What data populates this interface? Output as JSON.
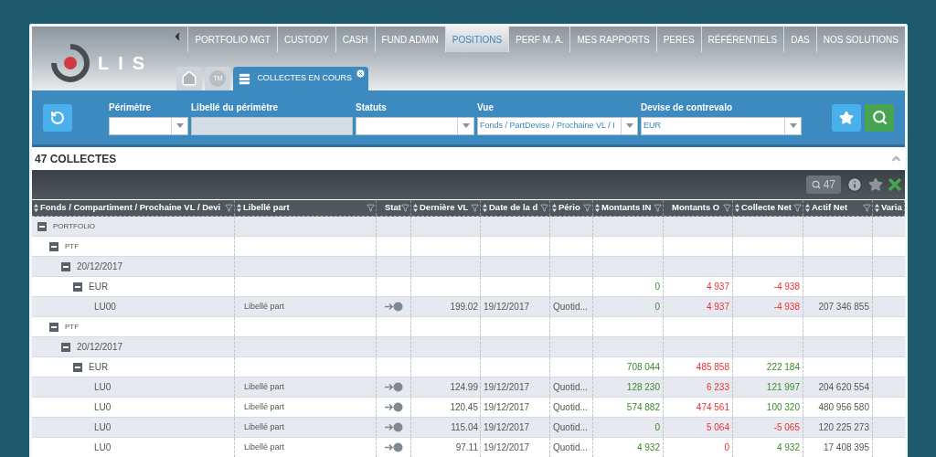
{
  "logo": {
    "text": "LIS"
  },
  "nav": {
    "tabs": [
      {
        "label": "PORTFOLIO MGT",
        "selected": false
      },
      {
        "label": "CUSTODY",
        "selected": false
      },
      {
        "label": "CASH",
        "selected": false
      },
      {
        "label": "FUND ADMIN",
        "selected": false
      },
      {
        "label": "POSITIONS",
        "selected": true
      },
      {
        "label": "PERF M. A.",
        "selected": false
      },
      {
        "label": "MES RAPPORTS",
        "selected": false
      },
      {
        "label": "PERES",
        "selected": false
      },
      {
        "label": "RÉFÉRENTIELS",
        "selected": false
      },
      {
        "label": "DAS",
        "selected": false
      },
      {
        "label": "NOS SOLUTIONS",
        "selected": false
      }
    ]
  },
  "subtabs": [
    {
      "kind": "home",
      "selected": false
    },
    {
      "kind": "badge",
      "label": "TM",
      "selected": false
    },
    {
      "kind": "page",
      "label": "COLLECTES EN COURS",
      "selected": true
    }
  ],
  "filters": [
    {
      "kind": "select",
      "label": "Périmètre"
    },
    {
      "kind": "readonly",
      "label": "Libellé du périmètre"
    },
    {
      "kind": "select",
      "label": "Statuts"
    },
    {
      "kind": "select",
      "label": "Vue",
      "value": "Fonds / PartDevise / Prochaine VL / I"
    },
    {
      "kind": "select",
      "label": "Devise de contrevalo",
      "value": "EUR"
    }
  ],
  "section": {
    "title": "47 COLLECTES"
  },
  "toolbar": {
    "count": "47"
  },
  "table": {
    "columns": [
      {
        "label": "Fonds / Compartiment / Prochaine VL / Devi",
        "sortable": true,
        "filter": true
      },
      {
        "label": "Libellé part",
        "sortable": true,
        "filter": true
      },
      {
        "label": "Stat",
        "sortable": false,
        "filter": true
      },
      {
        "label": "Dernière VL",
        "sortable": true,
        "filter": true
      },
      {
        "label": "Date de la d",
        "sortable": true,
        "filter": true
      },
      {
        "label": "Pério",
        "sortable": true,
        "filter": true
      },
      {
        "label": "Montants IN",
        "sortable": true,
        "filter": true
      },
      {
        "label": "Montants O",
        "sortable": false,
        "filter": true
      },
      {
        "label": "Collecte Net",
        "sortable": true,
        "filter": true
      },
      {
        "label": "Actif Net",
        "sortable": true,
        "filter": true
      },
      {
        "label": "Varia",
        "sortable": true,
        "filter": false
      }
    ],
    "rows": [
      {
        "label": "PORTFOLIO",
        "expanded": true,
        "children": [
          {
            "label": "PTF",
            "expanded": true,
            "children": [
              {
                "label": "20/12/2017",
                "expanded": true,
                "children": [
                  {
                    "label": "EUR",
                    "expanded": true,
                    "in": "0",
                    "out": "4 937",
                    "net": "-4 938",
                    "net_negative": true,
                    "children": [
                      {
                        "label": "LU00",
                        "libelle": "Libellé part",
                        "vl": "199.02",
                        "date": "19/12/2017",
                        "periode": "Quotid...",
                        "in": "0",
                        "out": "4 937",
                        "net": "-4 938",
                        "net_negative": true,
                        "actif": "207 346 855"
                      }
                    ]
                  }
                ]
              }
            ]
          },
          {
            "label": "PTF",
            "expanded": true,
            "children": [
              {
                "label": "20/12/2017",
                "expanded": true,
                "children": [
                  {
                    "label": "EUR",
                    "expanded": true,
                    "in": "708 044",
                    "out": "485 858",
                    "net": "222 184",
                    "net_negative": false,
                    "children": [
                      {
                        "label": "LU0",
                        "libelle": "Libellé part",
                        "vl": "124.99",
                        "date": "19/12/2017",
                        "periode": "Quotid...",
                        "in": "128 230",
                        "out": "6 233",
                        "net": "121 997",
                        "net_negative": false,
                        "actif": "204 620 554"
                      },
                      {
                        "label": "LU0",
                        "libelle": "Libellé part",
                        "vl": "120.45",
                        "date": "19/12/2017",
                        "periode": "Quotid...",
                        "in": "574 882",
                        "out": "474 561",
                        "net": "100 320",
                        "net_negative": false,
                        "actif": "480 956 580"
                      },
                      {
                        "label": "LU0",
                        "libelle": "Libellé part",
                        "vl": "115.04",
                        "date": "19/12/2017",
                        "periode": "Quotid...",
                        "in": "0",
                        "out": "5 064",
                        "net": "-5 065",
                        "net_negative": true,
                        "actif": "120 225 273"
                      },
                      {
                        "label": "LU0",
                        "libelle": "Libellé part",
                        "vl": "97.11",
                        "date": "19/12/2017",
                        "periode": "Quotid...",
                        "in": "4 932",
                        "out": "0",
                        "net": "4 932",
                        "net_negative": false,
                        "actif": "17 408 395"
                      }
                    ]
                  }
                ]
              }
            ]
          }
        ]
      }
    ]
  }
}
